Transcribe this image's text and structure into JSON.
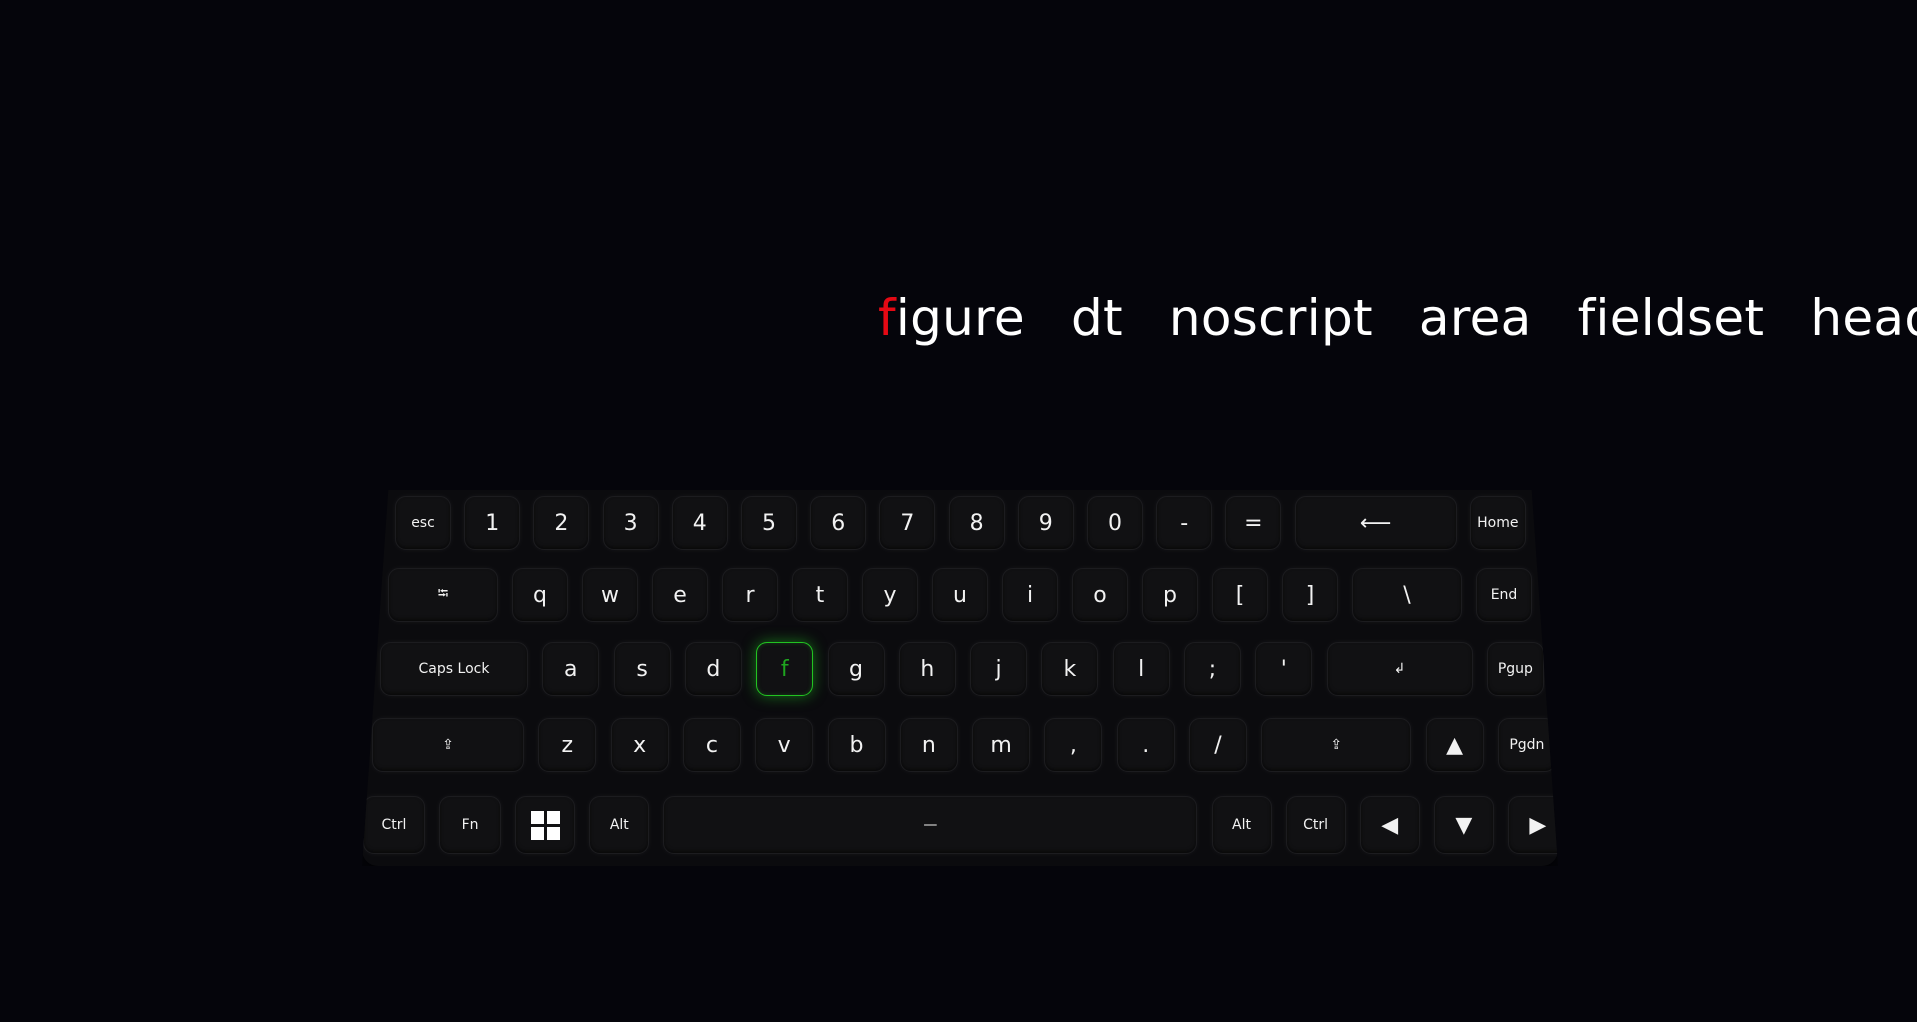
{
  "typing": {
    "words": [
      {
        "typed": "f",
        "rest": "igure"
      },
      {
        "typed": "",
        "rest": "dt"
      },
      {
        "typed": "",
        "rest": "noscript"
      },
      {
        "typed": "",
        "rest": "area"
      },
      {
        "typed": "",
        "rest": "fieldset"
      },
      {
        "typed": "",
        "rest": "head"
      }
    ],
    "typed_color": "#e50914",
    "text_color": "#ffffff"
  },
  "keyboard": {
    "active_key": "f",
    "active_color": "#22c322",
    "rows": [
      {
        "keys": [
          {
            "label": "esc",
            "name": "key-esc",
            "small": true
          },
          {
            "label": "1",
            "name": "key-1"
          },
          {
            "label": "2",
            "name": "key-2"
          },
          {
            "label": "3",
            "name": "key-3"
          },
          {
            "label": "4",
            "name": "key-4"
          },
          {
            "label": "5",
            "name": "key-5"
          },
          {
            "label": "6",
            "name": "key-6"
          },
          {
            "label": "7",
            "name": "key-7"
          },
          {
            "label": "8",
            "name": "key-8"
          },
          {
            "label": "9",
            "name": "key-9"
          },
          {
            "label": "0",
            "name": "key-0"
          },
          {
            "label": "-",
            "name": "key-minus"
          },
          {
            "label": "=",
            "name": "key-equals"
          },
          {
            "label": "⟵",
            "name": "key-backspace"
          },
          {
            "label": "Home",
            "name": "key-home",
            "small": true
          }
        ]
      },
      {
        "keys": [
          {
            "label": "⭾",
            "name": "key-tab",
            "small": true
          },
          {
            "label": "q",
            "name": "key-q"
          },
          {
            "label": "w",
            "name": "key-w"
          },
          {
            "label": "e",
            "name": "key-e"
          },
          {
            "label": "r",
            "name": "key-r"
          },
          {
            "label": "t",
            "name": "key-t"
          },
          {
            "label": "y",
            "name": "key-y"
          },
          {
            "label": "u",
            "name": "key-u"
          },
          {
            "label": "i",
            "name": "key-i"
          },
          {
            "label": "o",
            "name": "key-o"
          },
          {
            "label": "p",
            "name": "key-p"
          },
          {
            "label": "[",
            "name": "key-left-bracket"
          },
          {
            "label": "]",
            "name": "key-right-bracket"
          },
          {
            "label": "\\",
            "name": "key-backslash"
          },
          {
            "label": "End",
            "name": "key-end",
            "small": true
          }
        ]
      },
      {
        "keys": [
          {
            "label": "Caps Lock",
            "name": "key-caps-lock",
            "small": true
          },
          {
            "label": "a",
            "name": "key-a"
          },
          {
            "label": "s",
            "name": "key-s"
          },
          {
            "label": "d",
            "name": "key-d"
          },
          {
            "label": "f",
            "name": "key-f"
          },
          {
            "label": "g",
            "name": "key-g"
          },
          {
            "label": "h",
            "name": "key-h"
          },
          {
            "label": "j",
            "name": "key-j"
          },
          {
            "label": "k",
            "name": "key-k"
          },
          {
            "label": "l",
            "name": "key-l"
          },
          {
            "label": ";",
            "name": "key-semicolon"
          },
          {
            "label": "'",
            "name": "key-quote"
          },
          {
            "label": "↲",
            "name": "key-enter",
            "small": true
          },
          {
            "label": "Pgup",
            "name": "key-pgup",
            "small": true
          }
        ]
      },
      {
        "keys": [
          {
            "label": "⇪",
            "name": "key-left-shift",
            "small": true
          },
          {
            "label": "z",
            "name": "key-z"
          },
          {
            "label": "x",
            "name": "key-x"
          },
          {
            "label": "c",
            "name": "key-c"
          },
          {
            "label": "v",
            "name": "key-v"
          },
          {
            "label": "b",
            "name": "key-b"
          },
          {
            "label": "n",
            "name": "key-n"
          },
          {
            "label": "m",
            "name": "key-m"
          },
          {
            "label": ",",
            "name": "key-comma"
          },
          {
            "label": ".",
            "name": "key-period"
          },
          {
            "label": "/",
            "name": "key-slash"
          },
          {
            "label": "⇪",
            "name": "key-right-shift",
            "small": true
          },
          {
            "label": "▲",
            "name": "key-arrow-up"
          },
          {
            "label": "Pgdn",
            "name": "key-pgdn",
            "small": true
          }
        ]
      },
      {
        "keys": [
          {
            "label": "Ctrl",
            "name": "key-left-ctrl",
            "small": true
          },
          {
            "label": "Fn",
            "name": "key-fn",
            "small": true
          },
          {
            "label": "",
            "name": "key-windows",
            "icon": "windows-logo-icon"
          },
          {
            "label": "Alt",
            "name": "key-left-alt",
            "small": true
          },
          {
            "label": "—",
            "name": "key-space",
            "small": true
          },
          {
            "label": "Alt",
            "name": "key-right-alt",
            "small": true
          },
          {
            "label": "Ctrl",
            "name": "key-right-ctrl",
            "small": true
          },
          {
            "label": "◀",
            "name": "key-arrow-left"
          },
          {
            "label": "▼",
            "name": "key-arrow-down"
          },
          {
            "label": "▶",
            "name": "key-arrow-right"
          }
        ]
      }
    ]
  }
}
